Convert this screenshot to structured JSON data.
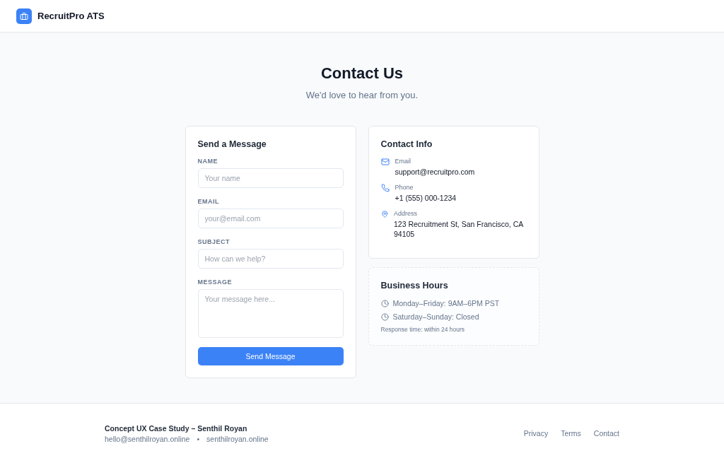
{
  "header": {
    "brand": "RecruitPro ATS"
  },
  "hero": {
    "title": "Contact Us",
    "subtitle": "We'd love to hear from you."
  },
  "form": {
    "title": "Send a Message",
    "fields": [
      {
        "label": "NAME",
        "placeholder": "Your name",
        "kind": "input"
      },
      {
        "label": "EMAIL",
        "placeholder": "your@email.com",
        "kind": "input"
      },
      {
        "label": "SUBJECT",
        "placeholder": "How can we help?",
        "kind": "input"
      },
      {
        "label": "MESSAGE",
        "placeholder": "Your message here...",
        "kind": "textarea"
      }
    ],
    "submit": "Send Message"
  },
  "contact_info": {
    "title": "Contact Info",
    "items": [
      {
        "kind": "email",
        "label": "Email",
        "value": "support@recruitpro.com"
      },
      {
        "kind": "phone",
        "label": "Phone",
        "value": "+1 (555) 000-1234"
      },
      {
        "kind": "address",
        "label": "Address",
        "value": "123 Recruitment St, San Francisco, CA 94105"
      }
    ]
  },
  "business_hours": {
    "title": "Business Hours",
    "hours": [
      "Monday–Friday: 9AM–6PM PST",
      "Saturday–Sunday: Closed"
    ],
    "note": "Response time: within 24 hours"
  },
  "footer": {
    "credit": "Concept UX Case Study – Senthil Royan",
    "email": "hello@senthilroyan.online",
    "separator": "•",
    "website": "senthilroyan.online",
    "links": [
      "Privacy",
      "Terms",
      "Contact"
    ]
  }
}
